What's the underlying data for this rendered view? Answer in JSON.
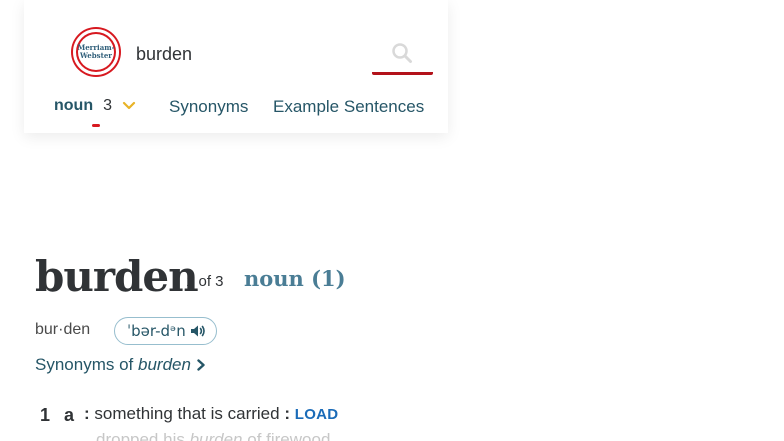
{
  "header": {
    "logo_line1": "Merriam-",
    "logo_line2": "Webster",
    "search_value": "burden"
  },
  "nav": {
    "pos_label": "noun",
    "pos_count": "3",
    "synonyms_label": "Synonyms",
    "examples_label": "Example Sentences"
  },
  "entry": {
    "headword": "burden",
    "entry_number": "1 of 3",
    "function_label": "noun (1)",
    "hyphenation": "bur·den",
    "pronunciation": "ˈbər-dᵊn",
    "synonyms_prefix": "Synonyms of ",
    "synonyms_word": "burden",
    "sense_number": "1",
    "sense_letter": "a",
    "sense_colon": ":",
    "sense_text": " something that is carried ",
    "sense_colon2": ":",
    "xref": "LOAD",
    "example_prefix": "dropped his ",
    "example_word": "burden",
    "example_suffix": " of firewood"
  },
  "colors": {
    "brand_red": "#d71920",
    "link_blue": "#265667",
    "function_label": "#4a7d95",
    "xref_blue": "#1a6bb8"
  }
}
